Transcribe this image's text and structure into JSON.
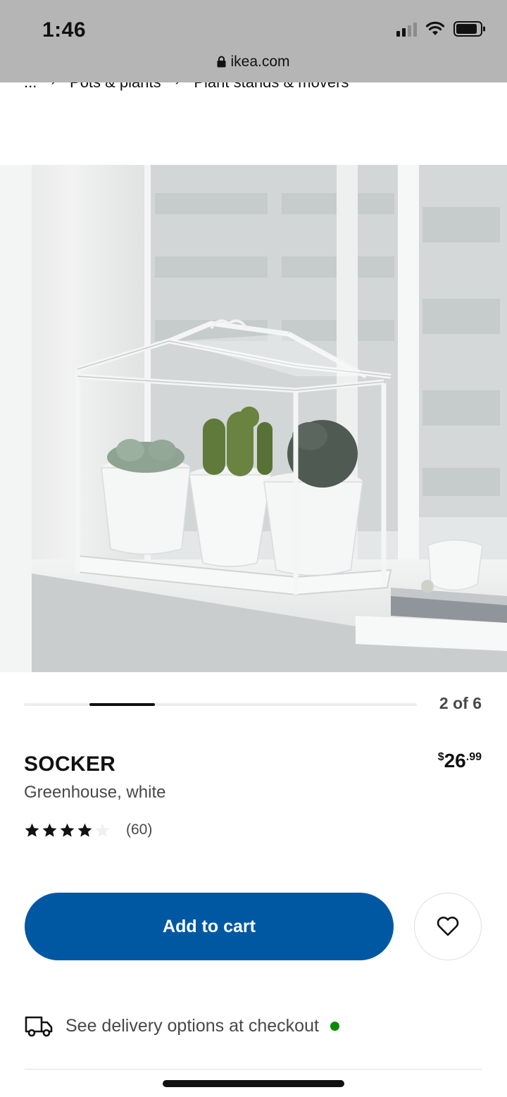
{
  "status_bar": {
    "time": "1:46",
    "icons": [
      "cellular-signal-icon",
      "wifi-icon",
      "battery-icon"
    ]
  },
  "browser": {
    "url": "ikea.com",
    "icon": "lock-icon"
  },
  "breadcrumb": {
    "items": [
      "...",
      "Pots & plants",
      "Plant stands & movers"
    ]
  },
  "gallery": {
    "counter": "2 of 6",
    "current": 2,
    "total": 6
  },
  "product": {
    "name": "SOCKER",
    "description": "Greenhouse, white",
    "price": {
      "currency": "$",
      "integer": "26",
      "decimal": ".99"
    },
    "rating": {
      "stars": 4,
      "max": 5,
      "count_label": "(60)"
    }
  },
  "actions": {
    "add_to_cart": "Add to cart",
    "favourite_icon": "heart-icon"
  },
  "delivery": {
    "text": "See delivery options at checkout",
    "icon": "truck-icon",
    "status_color": "#0a8a00"
  },
  "colors": {
    "brand_blue": "#0058a3",
    "status_bar_gray": "#b5b5b5"
  }
}
